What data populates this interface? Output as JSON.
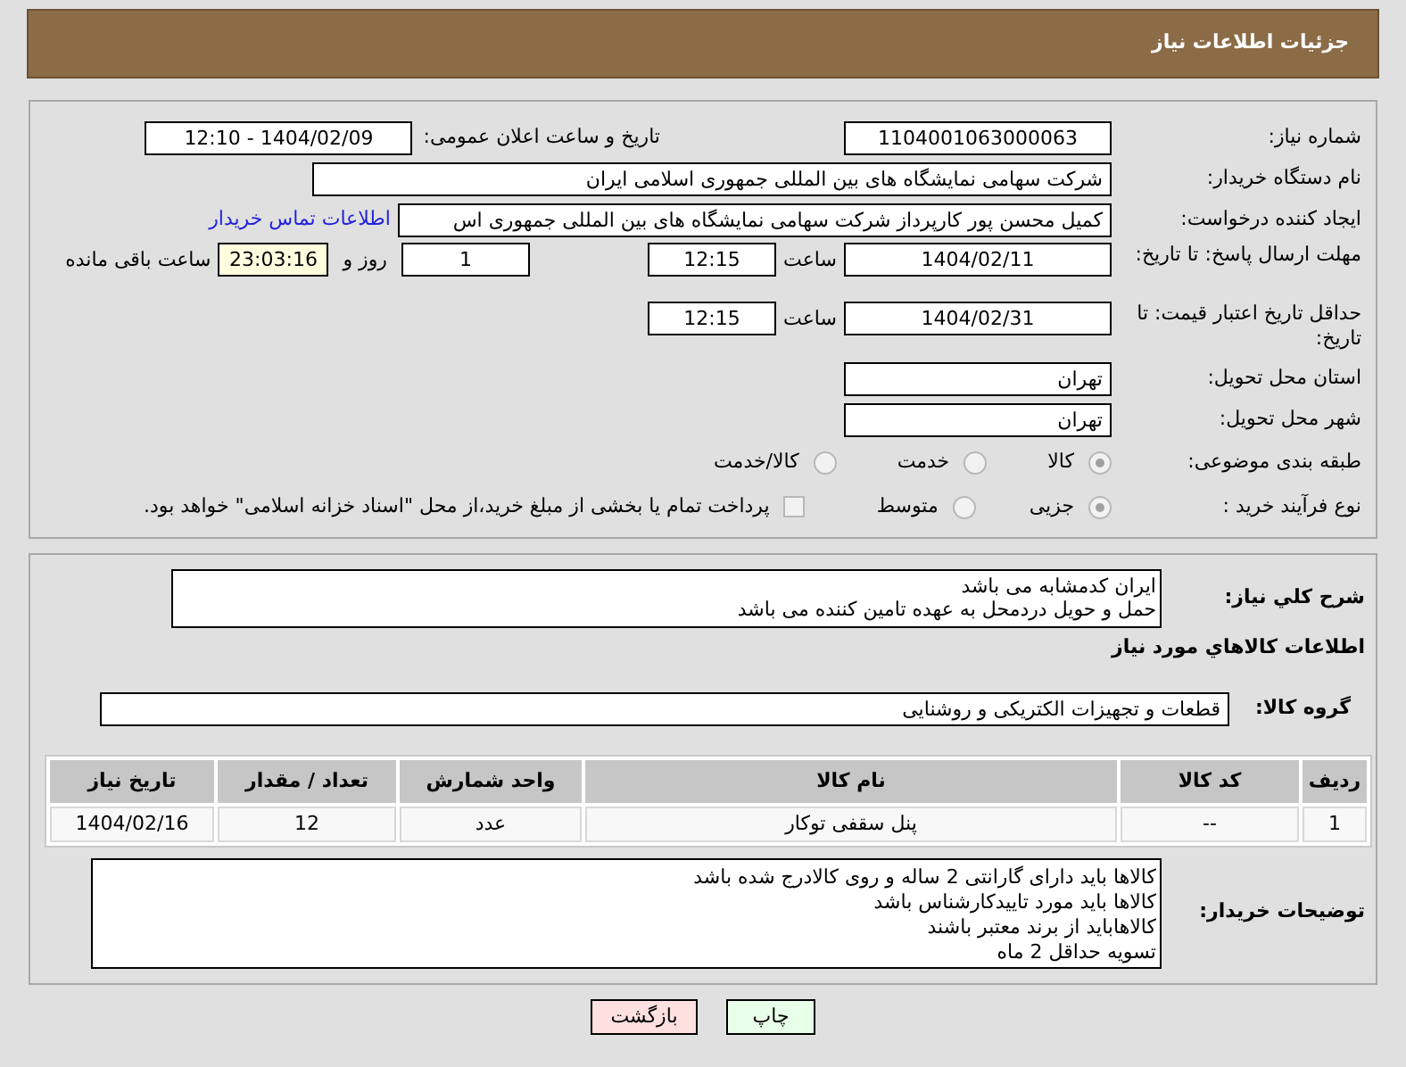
{
  "header": {
    "title": "جزئیات اطلاعات نیاز"
  },
  "need_number": {
    "label": "شماره نیاز:",
    "value": "1104001063000063"
  },
  "announce": {
    "label": "تاریخ و ساعت اعلان عمومی:",
    "value": "1404/02/09 - 12:10"
  },
  "buyer_org": {
    "label": "نام دستگاه خریدار:",
    "value": "شرکت سهامی نمایشگاه های بین المللی جمهوری اسلامی ایران"
  },
  "creator": {
    "label": "ایجاد کننده درخواست:",
    "value": "کمیل محسن پور کارپرداز شرکت سهامی نمایشگاه های بین المللی جمهوری اس",
    "link": "اطلاعات تماس خریدار"
  },
  "reply_deadline": {
    "label": "مهلت ارسال پاسخ: تا تاریخ:",
    "date": "1404/02/11",
    "time_label": "ساعت",
    "time": "12:15",
    "days": "1",
    "days_label": "روز و",
    "remaining": "23:03:16",
    "remaining_label": "ساعت باقی مانده"
  },
  "price_validity": {
    "label": "حداقل تاریخ اعتبار قیمت: تا تاریخ:",
    "date": "1404/02/31",
    "time_label": "ساعت",
    "time": "12:15"
  },
  "province": {
    "label": "استان محل تحویل:",
    "value": "تهران"
  },
  "city": {
    "label": "شهر محل تحویل:",
    "value": "تهران"
  },
  "category": {
    "label": "طبقه بندی موضوعی:",
    "options": [
      {
        "label": "کالا",
        "selected": true
      },
      {
        "label": "خدمت",
        "selected": false
      },
      {
        "label": "کالا/خدمت",
        "selected": false
      }
    ]
  },
  "purchase_type": {
    "label": "نوع فرآیند خرید :",
    "options": [
      {
        "label": "جزیی",
        "selected": true
      },
      {
        "label": "متوسط",
        "selected": false
      }
    ],
    "treasury": {
      "checked": false,
      "label": "پرداخت تمام یا بخشی از مبلغ خرید،از محل \"اسناد خزانه اسلامی\" خواهد بود."
    }
  },
  "description": {
    "label": "شرح کلي نياز:",
    "lines": [
      "ایران کدمشابه می باشد",
      "حمل و حویل دردمحل به عهده تامین کننده می باشد"
    ]
  },
  "goods_info": {
    "title": "اطلاعات کالاهاي مورد نياز"
  },
  "goods_group": {
    "label": "گروه کالا:",
    "value": "قطعات و تجهیزات الکتریکی و روشنایی"
  },
  "table": {
    "columns": [
      "ردیف",
      "کد کالا",
      "نام کالا",
      "واحد شمارش",
      "تعداد / مقدار",
      "تاریخ نیاز"
    ],
    "rows": [
      [
        "1",
        "--",
        "پنل سقفی توکار",
        "عدد",
        "12",
        "1404/02/16"
      ]
    ]
  },
  "buyer_notes": {
    "label": "توضیحات خریدار:",
    "lines": [
      "کالاها باید دارای گارانتی 2 ساله و روی کالادرج شده باشد",
      "کالاها باید مورد تاییدکارشناس باشد",
      "کالاهاباید از برند معتبر باشند",
      "تسویه حداقل 2 ماه"
    ]
  },
  "buttons": [
    {
      "label": "چاپ",
      "kind": "print"
    },
    {
      "label": "بازگشت",
      "kind": "back"
    }
  ]
}
